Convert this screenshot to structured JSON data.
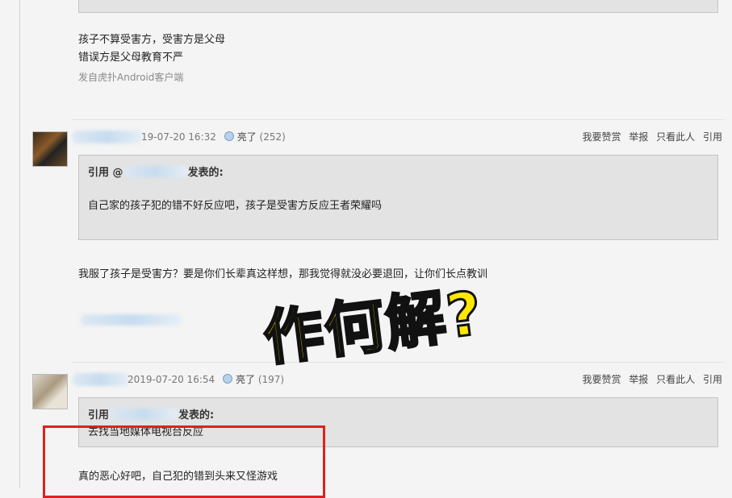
{
  "post1": {
    "line1": "孩子不算受害方，受害方是父母",
    "line2": "错误方是父母教育不严",
    "source": "发自虎扑Android客户端"
  },
  "post2": {
    "time": "19-07-20 16:32",
    "light": "亮了",
    "light_count": "(252)",
    "actions": [
      "我要赞赏",
      "举报",
      "只看此人",
      "引用"
    ],
    "quote_prefix": "引用 @",
    "quote_suffix": "发表的:",
    "quote_text": "自己家的孩子犯的错不好反应吧，孩子是受害方反应王者荣耀吗",
    "body": "我服了孩子是受害方？要是你们长辈真这样想，那我觉得就没必要退回，让你们长点教训"
  },
  "post3": {
    "time": "2019-07-20 16:54",
    "light": "亮了",
    "light_count": "(197)",
    "actions": [
      "我要赞赏",
      "举报",
      "只看此人",
      "引用"
    ],
    "quote_prefix": "引用",
    "quote_suffix": "发表的:",
    "quote_text": "去找当地媒体电视台反应",
    "body": "真的恶心好吧，自己犯的错到头来又怪游戏"
  },
  "overlay_text": "作何解?",
  "colors": {
    "highlight_border": "#e02020",
    "overlay_fill": "#ffe800",
    "quote_bg": "#e3e3e3"
  }
}
